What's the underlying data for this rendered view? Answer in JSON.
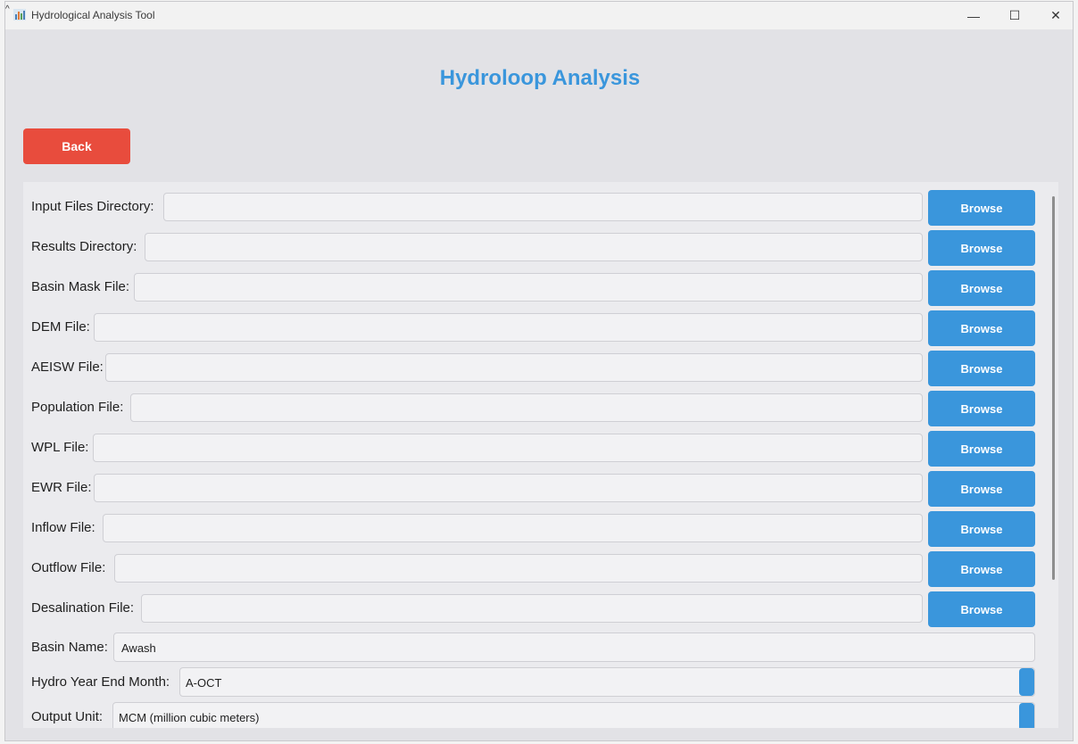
{
  "window": {
    "title": "Hydrological Analysis Tool",
    "minimize": "—",
    "maximize": "☐",
    "close": "✕",
    "caret": "^"
  },
  "header": {
    "title": "Hydroloop Analysis"
  },
  "back_button": {
    "label": "Back"
  },
  "file_rows": [
    {
      "label": "Input Files Directory:",
      "value": "",
      "button": "Browse"
    },
    {
      "label": "Results Directory:",
      "value": "",
      "button": "Browse"
    },
    {
      "label": "Basin Mask File:",
      "value": "",
      "button": "Browse"
    },
    {
      "label": "DEM File:",
      "value": "",
      "button": "Browse"
    },
    {
      "label": "AEISW File:",
      "value": "",
      "button": "Browse"
    },
    {
      "label": "Population File:",
      "value": "",
      "button": "Browse"
    },
    {
      "label": "WPL File:",
      "value": "",
      "button": "Browse"
    },
    {
      "label": "EWR File:",
      "value": "",
      "button": "Browse"
    },
    {
      "label": "Inflow File:",
      "value": "",
      "button": "Browse"
    },
    {
      "label": "Outflow File:",
      "value": "",
      "button": "Browse"
    },
    {
      "label": "Desalination File:",
      "value": "",
      "button": "Browse"
    }
  ],
  "basin_name": {
    "label": "Basin Name:",
    "value": "Awash"
  },
  "hydro_year_end_month": {
    "label": "Hydro Year End Month:",
    "value": "A-OCT"
  },
  "output_unit": {
    "label": "Output Unit:",
    "value": "MCM (million cubic meters)"
  },
  "colors": {
    "accent": "#3a96dc",
    "danger": "#e84c3d",
    "background": "#e2e2e6"
  }
}
